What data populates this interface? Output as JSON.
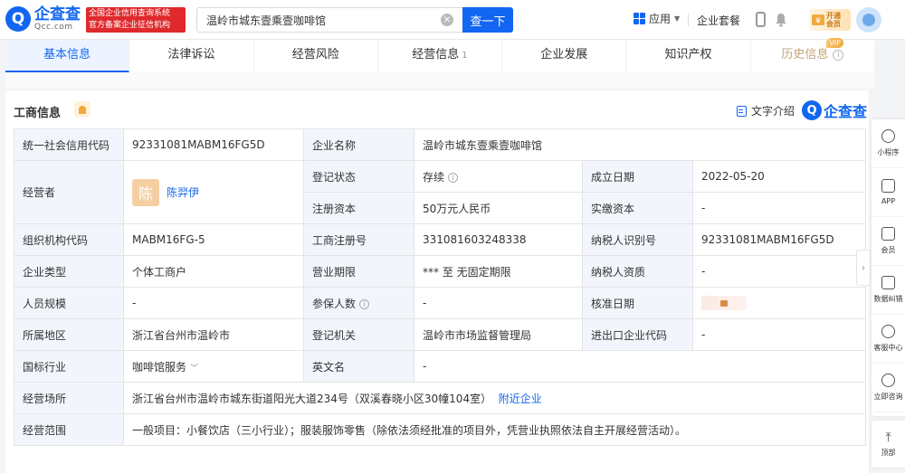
{
  "header": {
    "logo_mark": "Q",
    "logo_cn": "企查查",
    "logo_en": "Qcc.com",
    "slogan_line1": "全国企业信用查询系统",
    "slogan_line2": "官方备案企业征信机构",
    "search_value": "温岭市城东壹乘壹咖啡馆",
    "search_button": "查一下",
    "app_menu": "应用",
    "package": "企业套餐",
    "vip_line1": "开通",
    "vip_line2": "会员"
  },
  "tabs": [
    {
      "label": "基本信息",
      "count": ""
    },
    {
      "label": "法律诉讼",
      "count": ""
    },
    {
      "label": "经营风险",
      "count": ""
    },
    {
      "label": "经营信息",
      "count": "1"
    },
    {
      "label": "企业发展",
      "count": ""
    },
    {
      "label": "知识产权",
      "count": ""
    },
    {
      "label": "历史信息",
      "count": "",
      "badge": "VIP"
    }
  ],
  "section": {
    "title": "工商信息",
    "text_intro": "文字介绍",
    "brand": "企查查",
    "brand_mark": "Q"
  },
  "table": {
    "credit_code_label": "统一社会信用代码",
    "credit_code": "92331081MABM16FG5D",
    "name_label": "企业名称",
    "name": "温岭市城东壹乘壹咖啡馆",
    "operator_label": "经营者",
    "operator_avatar": "陈",
    "operator": "陈羿伊",
    "status_label": "登记状态",
    "status": "存续",
    "established_label": "成立日期",
    "established": "2022-05-20",
    "reg_capital_label": "注册资本",
    "reg_capital": "50万元人民币",
    "paid_capital_label": "实缴资本",
    "paid_capital": "-",
    "org_code_label": "组织机构代码",
    "org_code": "MABM16FG-5",
    "reg_no_label": "工商注册号",
    "reg_no": "331081603248338",
    "tax_id_label": "纳税人识别号",
    "tax_id": "92331081MABM16FG5D",
    "type_label": "企业类型",
    "type": "个体工商户",
    "term_label": "营业期限",
    "term": "*** 至 无固定期限",
    "taxpayer_label": "纳税人资质",
    "taxpayer": "-",
    "staff_label": "人员规模",
    "staff": "-",
    "insured_label": "参保人数",
    "insured": "-",
    "approval_label": "核准日期",
    "region_label": "所属地区",
    "region": "浙江省台州市温岭市",
    "authority_label": "登记机关",
    "authority": "温岭市市场监督管理局",
    "ie_code_label": "进出口企业代码",
    "ie_code": "-",
    "industry_label": "国标行业",
    "industry": "咖啡馆服务",
    "en_name_label": "英文名",
    "en_name": "-",
    "address_label": "经营场所",
    "address": "浙江省台州市温岭市城东街道阳光大道234号（双溪春晓小区30幢104室）",
    "nearby": "附近企业",
    "scope_label": "经营范围",
    "scope": "一般项目：小餐饮店（三小行业）；服装服饰零售（除依法须经批准的项目外，凭营业执照依法自主开展经营活动）。"
  },
  "rail": [
    {
      "label": "小程序",
      "icon": "mini-program-icon"
    },
    {
      "label": "APP",
      "icon": "phone-icon"
    },
    {
      "label": "会员",
      "icon": "vip-icon"
    },
    {
      "label": "数据纠错",
      "icon": "edit-icon"
    },
    {
      "label": "客服中心",
      "icon": "headset-icon"
    },
    {
      "label": "立即咨询",
      "icon": "chat-icon"
    }
  ],
  "rail_top": "顶部",
  "colors": {
    "brand": "#1266f1",
    "label_bg": "#f2f6fc",
    "vip": "#f0a93b"
  }
}
